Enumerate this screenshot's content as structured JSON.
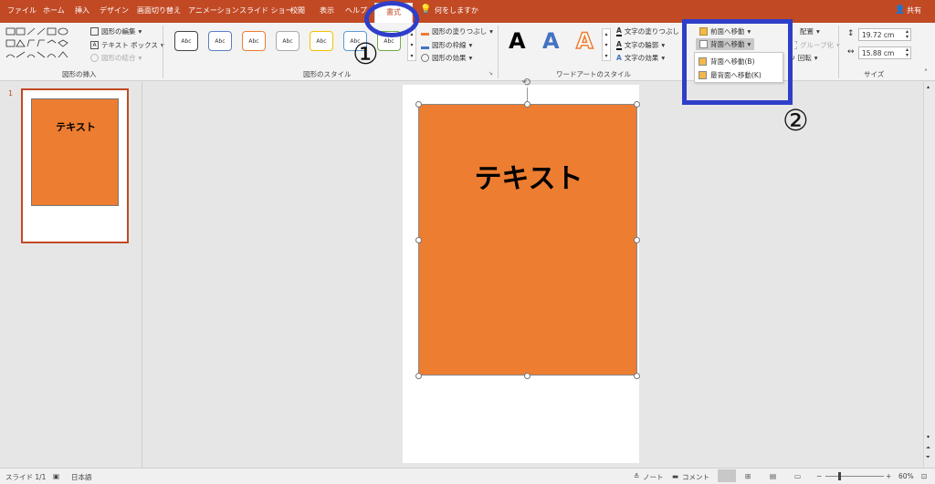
{
  "tabs": [
    "ファイル",
    "ホーム",
    "挿入",
    "デザイン",
    "画面切り替え",
    "アニメーション",
    "スライド ショー",
    "校閲",
    "表示",
    "ヘルプ"
  ],
  "active_tab": "書式",
  "tell_me": "何をしますか",
  "share": "共有",
  "ribbon": {
    "insert_shapes": {
      "edit_shape": "図形の編集",
      "text_box": "テキスト ボックス",
      "merge_shapes": "図形の結合",
      "label": "図形の挿入"
    },
    "shape_styles": {
      "samples": [
        "Abc",
        "Abc",
        "Abc",
        "Abc",
        "Abc",
        "Abc",
        "Abc"
      ],
      "fill": "図形の塗りつぶし",
      "outline": "図形の枠線",
      "effects": "図形の効果",
      "label": "図形のスタイル"
    },
    "wordart": {
      "letters": [
        "A",
        "A",
        "A"
      ],
      "text_fill": "文字の塗りつぶし",
      "text_outline": "文字の輪郭",
      "text_effects": "文字の効果",
      "label": "ワードアートのスタイル"
    },
    "arrange": {
      "bring_forward": "前面へ移動",
      "send_backward": "背面へ移動",
      "align": "配置",
      "group": "グループ化",
      "rotate": "回転"
    },
    "size": {
      "height": "19.72 cm",
      "width": "15.88 cm",
      "label": "サイズ"
    }
  },
  "dropdown": {
    "items": [
      "背面へ移動(B)",
      "最背面へ移動(K)"
    ]
  },
  "thumbnail": {
    "number": "1",
    "text": "テキスト"
  },
  "slide": {
    "shape_text": "テキスト"
  },
  "annotations": {
    "one": "①",
    "two": "②"
  },
  "status": {
    "slide_info": "スライド 1/1",
    "language": "日本語",
    "notes": "ノート",
    "comments": "コメント",
    "zoom": "60%"
  },
  "colors": {
    "accent": "#c14a25",
    "shape": "#ed7d31",
    "annotation": "#2f3ec9"
  }
}
